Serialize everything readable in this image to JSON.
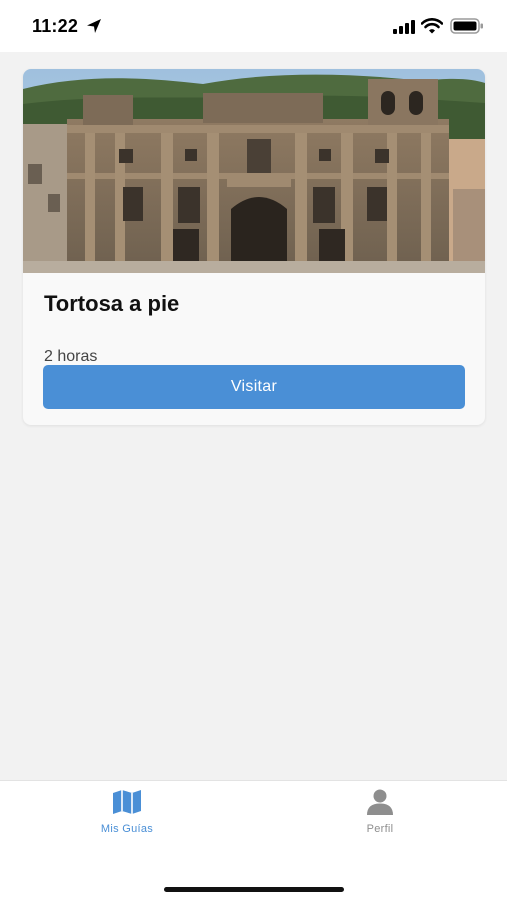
{
  "status_bar": {
    "time": "11:22",
    "icons": [
      "location-arrow-icon",
      "cellular-signal-icon",
      "wifi-icon",
      "battery-icon"
    ]
  },
  "guides": [
    {
      "image": "cathedral-facade-photo",
      "title": "Tortosa a pie",
      "duration": "2 horas",
      "visit_label": "Visitar"
    }
  ],
  "tab_bar": {
    "tabs": [
      {
        "label": "Mis Guías",
        "icon": "map-icon",
        "active": true
      },
      {
        "label": "Perfil",
        "icon": "person-icon",
        "active": false
      }
    ]
  },
  "colors": {
    "accent": "#4a8fd6",
    "background": "#f2f2f2",
    "card": "#f9f9f9",
    "inactive": "#8e8e8e"
  }
}
